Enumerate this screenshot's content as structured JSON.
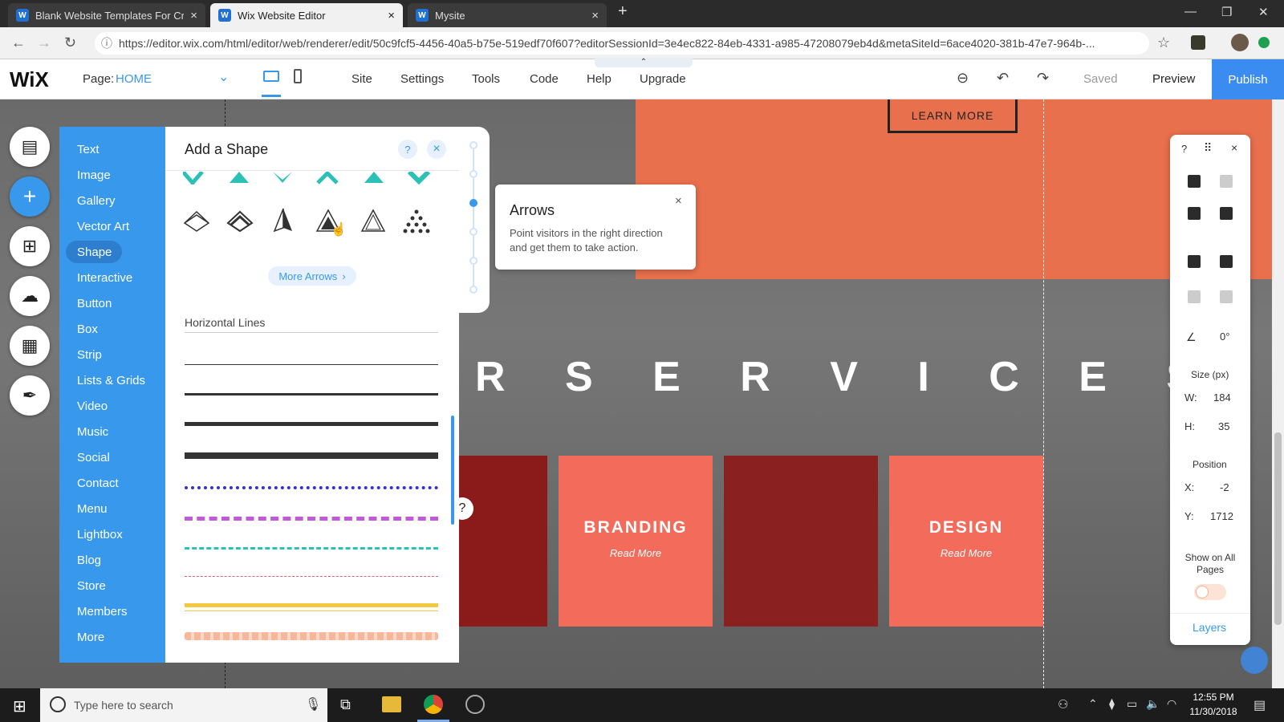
{
  "browser": {
    "tabs": [
      {
        "label": "Blank Website Templates For Cre",
        "icon": "wix-favicon"
      },
      {
        "label": "Wix Website Editor",
        "icon": "wix-favicon"
      },
      {
        "label": "Mysite",
        "icon": "wix-favicon"
      }
    ],
    "url": "https://editor.wix.com/html/editor/web/renderer/edit/50c9fcf5-4456-40a5-b75e-519edf70f607?editorSessionId=3e4ec822-84eb-4331-a985-47208079eb4d&metaSiteId=6ace4020-381b-47e7-964b-..."
  },
  "wix": {
    "logo": "WiX",
    "page_label": "Page:",
    "page_value": "HOME",
    "menu": [
      "Site",
      "Settings",
      "Tools",
      "Code",
      "Help",
      "Upgrade"
    ],
    "saved": "Saved",
    "preview": "Preview",
    "publish": "Publish"
  },
  "canvas": {
    "learn_more": "LEARN MORE",
    "services": "R S E R V I C E S",
    "cards": [
      {
        "title": "BRANDING",
        "sub": "Read More"
      },
      {
        "title": "DESIGN",
        "sub": "Read More"
      }
    ]
  },
  "add_menu": {
    "items": [
      "Text",
      "Image",
      "Gallery",
      "Vector Art",
      "Shape",
      "Interactive",
      "Button",
      "Box",
      "Strip",
      "Lists & Grids",
      "Video",
      "Music",
      "Social",
      "Contact",
      "Menu",
      "Lightbox",
      "Blog",
      "Store",
      "Members",
      "More"
    ],
    "selected": "Shape"
  },
  "shape_panel": {
    "title": "Add a Shape",
    "help": "?",
    "close": "×",
    "more_arrows": "More Arrows",
    "section": "Horizontal Lines"
  },
  "tooltip": {
    "title": "Arrows",
    "body": "Point visitors in the right direction and get them to take action.",
    "close": "×"
  },
  "tools": {
    "help": "?",
    "close": "×",
    "angle": "0°",
    "size_label": "Size (px)",
    "w_label": "W:",
    "w_value": "184",
    "h_label": "H:",
    "h_value": "35",
    "position_label": "Position",
    "x_label": "X:",
    "x_value": "-2",
    "y_label": "Y:",
    "y_value": "1712",
    "show_all": "Show on All Pages",
    "layers": "Layers"
  },
  "taskbar": {
    "search_placeholder": "Type here to search",
    "time": "12:55 PM",
    "date": "11/30/2018"
  },
  "colors": {
    "wix_blue": "#3899ec",
    "accent_orange": "#e8704c",
    "card_coral": "#f26b5b",
    "card_dark": "#8b1a1a"
  }
}
